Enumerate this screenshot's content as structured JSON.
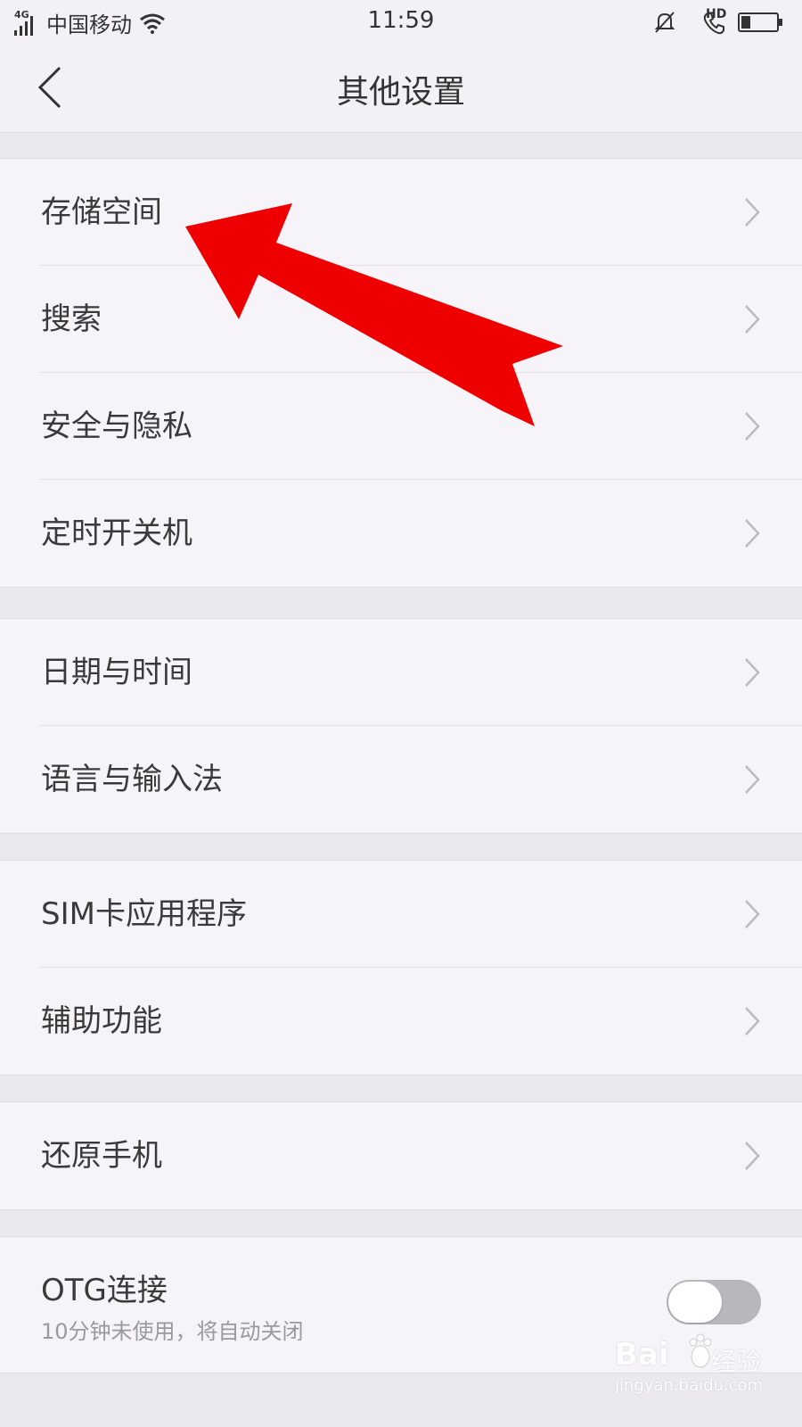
{
  "status_bar": {
    "network_type": "4G",
    "carrier": "中国移动",
    "time": "11:59",
    "hd_label": "HD",
    "icons": [
      "signal-icon",
      "wifi-icon",
      "bell-muted-icon",
      "hd-call-icon",
      "battery-icon"
    ],
    "battery_level": 0.25
  },
  "header": {
    "title": "其他设置",
    "back_icon": "chevron-left-icon"
  },
  "groups": [
    {
      "items": [
        "存储空间",
        "搜索",
        "安全与隐私",
        "定时开关机"
      ]
    },
    {
      "items": [
        "日期与时间",
        "语言与输入法"
      ]
    },
    {
      "items": [
        "SIM卡应用程序",
        "辅助功能"
      ]
    },
    {
      "items": [
        "还原手机"
      ]
    }
  ],
  "otg": {
    "title": "OTG连接",
    "subtitle": "10分钟未使用，将自动关闭",
    "enabled": false
  },
  "annotation": {
    "color": "#ee0000",
    "points_to": "存储空间"
  },
  "watermark": {
    "brand_left": "Bai",
    "brand_right": "经验",
    "url": "jingyan.baidu.com"
  }
}
